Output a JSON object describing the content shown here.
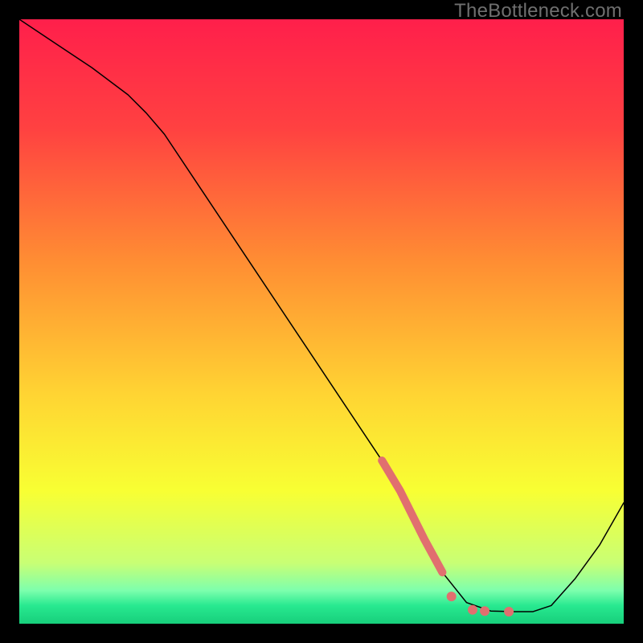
{
  "watermark": "TheBottleneck.com",
  "chart_data": {
    "type": "line",
    "title": "",
    "xlabel": "",
    "ylabel": "",
    "xlim": [
      0,
      100
    ],
    "ylim": [
      0,
      100
    ],
    "grid": false,
    "background_gradient": {
      "stops": [
        {
          "pos": 0.0,
          "color": "#ff1f4b"
        },
        {
          "pos": 0.18,
          "color": "#ff4141"
        },
        {
          "pos": 0.4,
          "color": "#ff8d33"
        },
        {
          "pos": 0.62,
          "color": "#ffd433"
        },
        {
          "pos": 0.78,
          "color": "#f8ff33"
        },
        {
          "pos": 0.9,
          "color": "#c8ff75"
        },
        {
          "pos": 0.945,
          "color": "#7dffad"
        },
        {
          "pos": 0.97,
          "color": "#28e990"
        },
        {
          "pos": 1.0,
          "color": "#17cf7b"
        }
      ]
    },
    "series": [
      {
        "name": "bottleneck-curve",
        "stroke": "#000000",
        "stroke_width": 1.5,
        "x": [
          0,
          6,
          12,
          18,
          21,
          24,
          30,
          38,
          46,
          54,
          60,
          63,
          65,
          67,
          70,
          74,
          78,
          82,
          85,
          88,
          92,
          96,
          100
        ],
        "y": [
          100,
          96,
          92,
          87.5,
          84.5,
          81,
          72,
          60,
          48,
          36,
          27,
          22,
          18,
          14,
          8.5,
          3.5,
          2.1,
          2.0,
          2.0,
          3.0,
          7.5,
          13,
          20
        ]
      },
      {
        "name": "highlight-segment",
        "stroke": "#e16f6f",
        "stroke_width": 10,
        "x": [
          60,
          63,
          65,
          67,
          70
        ],
        "y": [
          27,
          22,
          18,
          14,
          8.5
        ]
      }
    ],
    "highlight_dots": {
      "color": "#e16f6f",
      "radius": 6,
      "points": [
        {
          "x": 71.5,
          "y": 4.5
        },
        {
          "x": 75.0,
          "y": 2.3
        },
        {
          "x": 77.0,
          "y": 2.1
        },
        {
          "x": 81.0,
          "y": 2.0
        }
      ]
    }
  }
}
